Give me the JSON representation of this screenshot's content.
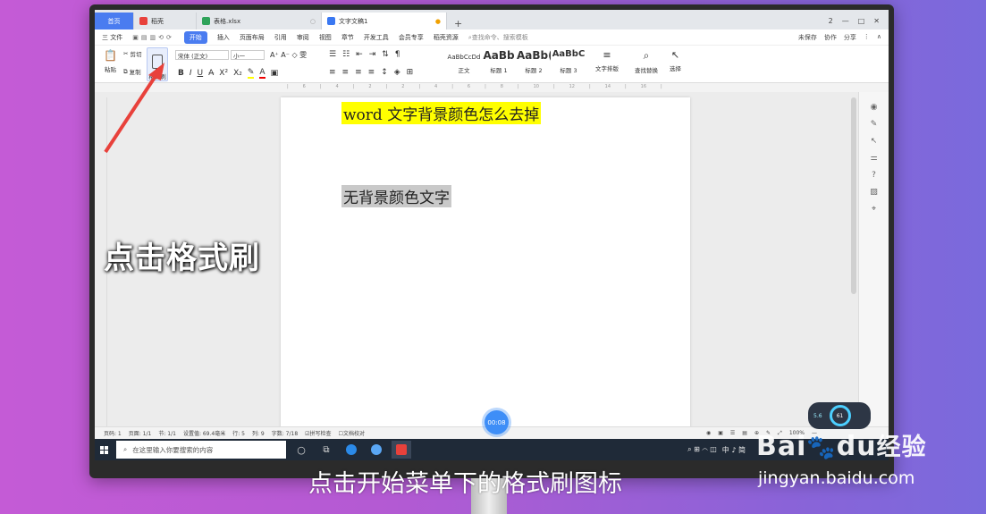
{
  "tabs": [
    {
      "label": "首页",
      "type": "home"
    },
    {
      "label": "稻壳",
      "type": "docer"
    },
    {
      "label": "表格.xlsx",
      "type": "sheet"
    },
    {
      "label": "文字文稿1",
      "type": "doc"
    }
  ],
  "window_controls": [
    "2",
    "—",
    "□",
    "✕"
  ],
  "menu": {
    "file": "三 文件",
    "items": [
      "开始",
      "插入",
      "页面布局",
      "引用",
      "审阅",
      "视图",
      "章节",
      "开发工具",
      "会员专享",
      "稻壳资源"
    ],
    "search_placeholder": "查找命令、搜索模板",
    "right": [
      "未保存",
      "协作",
      "分享"
    ]
  },
  "ribbon": {
    "paste": "粘贴",
    "cut": "剪切",
    "copy": "复制",
    "format_painter": "格式刷",
    "font_name": "宋体 (正文)",
    "font_size": "小一",
    "styles": [
      {
        "sample": "AaBbCcDd",
        "label": "正文"
      },
      {
        "sample": "AaBb",
        "label": "标题 1"
      },
      {
        "sample": "AaBb(",
        "label": "标题 2"
      },
      {
        "sample": "AaBbC",
        "label": "标题 3"
      }
    ],
    "text_layout": "文字排版",
    "find_replace": "查找替换",
    "select": "选择"
  },
  "document": {
    "line1": "word 文字背景颜色怎么去掉",
    "line2": "无背景颜色文字"
  },
  "statusbar": {
    "page_num": "页码: 1",
    "pages": "页面: 1/1",
    "section": "节: 1/1",
    "setting": "设置值: 69.4毫米",
    "row": "行: 5",
    "col": "列: 9",
    "word_count": "字数: 7/18",
    "spell_check": "拼写检查",
    "doc_proof": "文档校对",
    "zoom": "100%"
  },
  "taskbar": {
    "search_placeholder": "在这里输入你要搜索的内容",
    "tray": "中 ♪ 简"
  },
  "overlay": {
    "side_caption": "点击格式刷",
    "bottom_caption": "点击开始菜单下的格式刷图标",
    "timer": "00:08",
    "widget_value": "5.6",
    "widget_percent": "61"
  },
  "watermark": {
    "brand": "Bai",
    "brand2": "du",
    "exp": "经验",
    "url": "jingyan.baidu.com"
  },
  "colors": {
    "accent": "#4a7cf0",
    "highlight_yellow": "#ffff00",
    "highlight_gray": "#c9c9c9",
    "arrow": "#e8413b"
  }
}
